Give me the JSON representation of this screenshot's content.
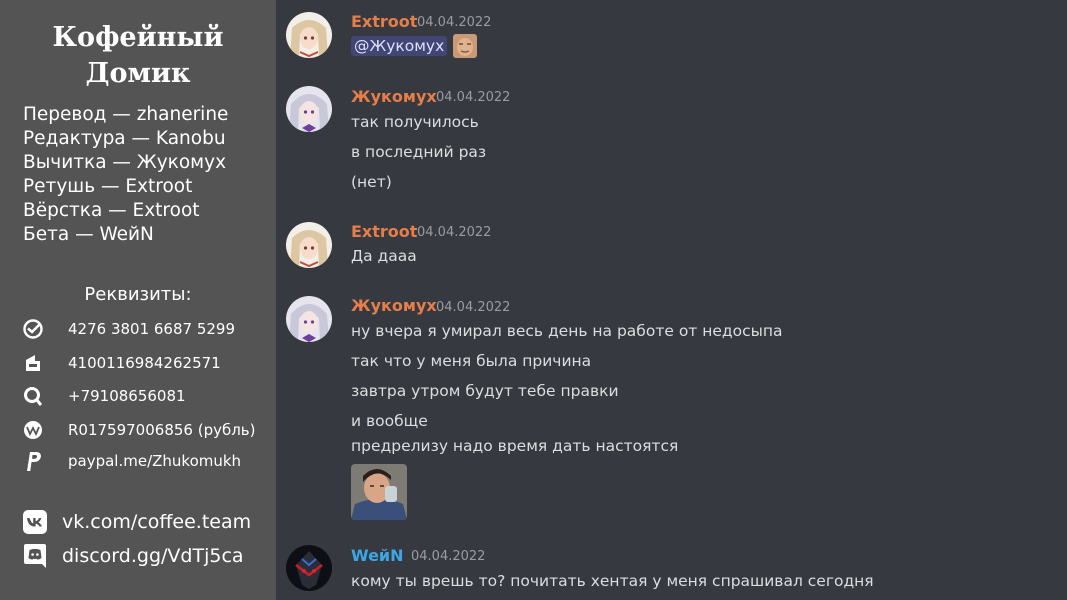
{
  "sidebar": {
    "title_line1": "Кофейный",
    "title_line2": "Домик",
    "credits": [
      "Перевод — zhanerine",
      "Редактура — Kanobu",
      "Вычитка — Жукомух",
      "Ретушь — Extroot",
      "Вёрстка — Extroot",
      "Бета — WeйN"
    ],
    "requisites_title": "Реквизиты:",
    "requisites": [
      {
        "icon": "sber-icon",
        "text": "4276 3801 6687 5299"
      },
      {
        "icon": "yoomoney-icon",
        "text": "4100116984262571"
      },
      {
        "icon": "qiwi-icon",
        "text": "+79108656081"
      },
      {
        "icon": "webmoney-icon",
        "text": "R017597006856 (рубль)"
      },
      {
        "icon": "paypal-icon",
        "text": "paypal.me/Zhukomukh"
      }
    ],
    "social": [
      {
        "icon": "vk-icon",
        "text": "vk.com/coffee.team"
      },
      {
        "icon": "discord-icon",
        "text": "discord.gg/VdTj5ca"
      }
    ]
  },
  "chat": {
    "colors": {
      "extroot": "#e67e4a",
      "zhukomukh": "#e67e4a",
      "wein": "#3ba7e6"
    },
    "messages": [
      {
        "author": "Extroot",
        "timestamp": "04.04.2022",
        "mention": "@Жукомух",
        "lines": []
      },
      {
        "author": "Жукомух",
        "timestamp": "04.04.2022",
        "lines": [
          "так получилось",
          "в последний раз",
          "(нет)"
        ]
      },
      {
        "author": "Extroot",
        "timestamp": "04.04.2022",
        "lines": [
          "Да дааа"
        ]
      },
      {
        "author": "Жукомух",
        "timestamp": "04.04.2022",
        "lines": [
          "ну вчера я умирал весь день на работе от недосыпа",
          "так что у меня была причина",
          "завтра утром будут тебе правки",
          "и вообще",
          "предрелизу надо время дать настоятся"
        ]
      },
      {
        "author": "WeйN",
        "timestamp": "04.04.2022",
        "lines": [
          "кому ты врешь то? почитать хентая у меня спрашивал сегодня"
        ]
      }
    ]
  }
}
